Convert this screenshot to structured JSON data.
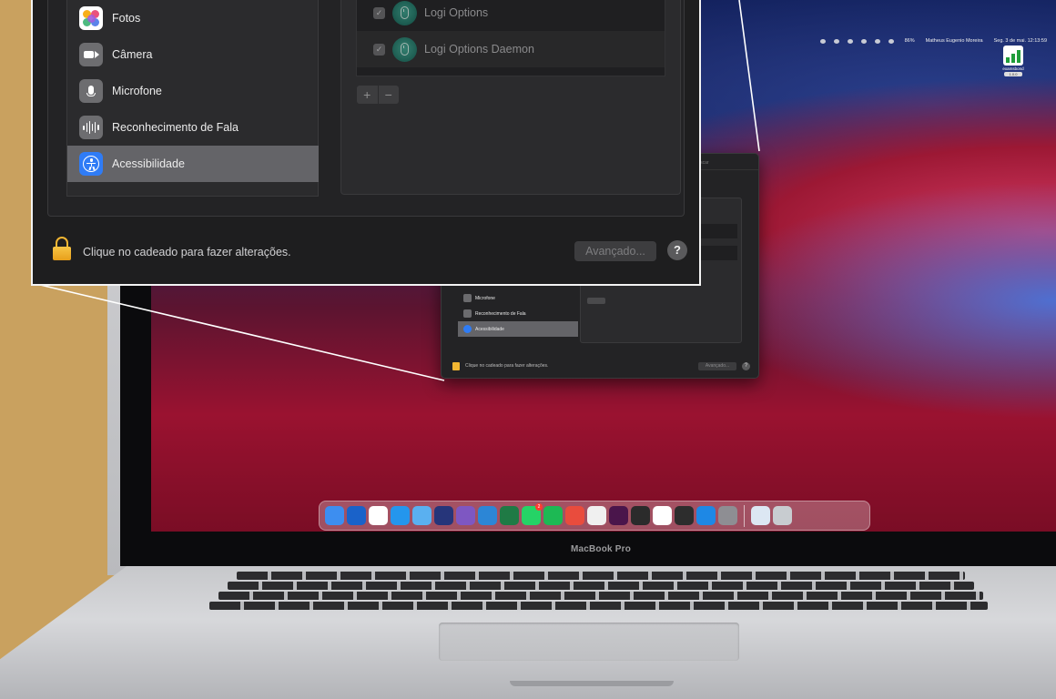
{
  "zoom_panel": {
    "privacy_categories": [
      {
        "label": "Fotos",
        "icon": "photos-icon",
        "selected": false
      },
      {
        "label": "Câmera",
        "icon": "camera-icon",
        "selected": false
      },
      {
        "label": "Microfone",
        "icon": "microphone-icon",
        "selected": false
      },
      {
        "label": "Reconhecimento de Fala",
        "icon": "speech-recognition-icon",
        "selected": false
      },
      {
        "label": "Acessibilidade",
        "icon": "accessibility-icon",
        "selected": true
      }
    ],
    "apps": [
      {
        "label": "Logi Options",
        "checked": true,
        "icon": "logi-options-icon"
      },
      {
        "label": "Logi Options Daemon",
        "checked": true,
        "icon": "logi-options-icon"
      }
    ],
    "add_label": "+",
    "remove_label": "−",
    "lock_text": "Clique no cadeado para fazer alterações.",
    "advanced_label": "Avançado...",
    "help_label": "?"
  },
  "desktop": {
    "menubar": {
      "battery": "86%",
      "user": "Matheus Eugenio Moreira",
      "datetime": "Seg. 3 de mai.  12:13:59"
    },
    "widget": {
      "label": "examsbond",
      "version": "1.0.0"
    },
    "mini_window": {
      "title": "Buscar",
      "items": [
        {
          "label": "Microfone",
          "selected": false
        },
        {
          "label": "Reconhecimento de Fala",
          "selected": false
        },
        {
          "label": "Acessibilidade",
          "selected": true
        }
      ],
      "lock_text": "Clique no cadeado para fazer alterações.",
      "advanced_label": "Avançado...",
      "help_label": "?"
    },
    "dock": {
      "apps": [
        {
          "name": "finder",
          "color": "#3d8ef0"
        },
        {
          "name": "1password",
          "color": "#1a62c9"
        },
        {
          "name": "calendar",
          "color": "#ffffff",
          "text_month": "MAI",
          "text_day": "3"
        },
        {
          "name": "docker",
          "color": "#2496ed"
        },
        {
          "name": "network-tool",
          "color": "#5ab0f0"
        },
        {
          "name": "grid-app",
          "color": "#26357a"
        },
        {
          "name": "visual-studio",
          "color": "#7e57c2"
        },
        {
          "name": "vscode",
          "color": "#2c86d6"
        },
        {
          "name": "excel",
          "color": "#1f7a45"
        },
        {
          "name": "whatsapp",
          "color": "#25d366",
          "badge": "2"
        },
        {
          "name": "spotify",
          "color": "#1db954"
        },
        {
          "name": "crossover",
          "color": "#e94c3d"
        },
        {
          "name": "chrome-dev",
          "color": "#f0f0f0",
          "text": "Dev"
        },
        {
          "name": "slack",
          "color": "#4a154b"
        },
        {
          "name": "terminal",
          "color": "#2b2b2b"
        },
        {
          "name": "notion",
          "color": "#ffffff"
        },
        {
          "name": "activity-monitor",
          "color": "#2d2d2d"
        },
        {
          "name": "safari",
          "color": "#1e88e5"
        },
        {
          "name": "system-preferences",
          "color": "#8e8e93"
        },
        {
          "name": "downloads-folder",
          "color": "#dce7f3"
        },
        {
          "name": "trash",
          "color": "#c8ccd0"
        }
      ]
    },
    "laptop_label": "MacBook Pro"
  },
  "colors": {
    "selected_row": "#646468",
    "accessibility_blue": "#2f7cf6",
    "lock_yellow": "#f2b632",
    "desk_background": "#c9a15f"
  }
}
